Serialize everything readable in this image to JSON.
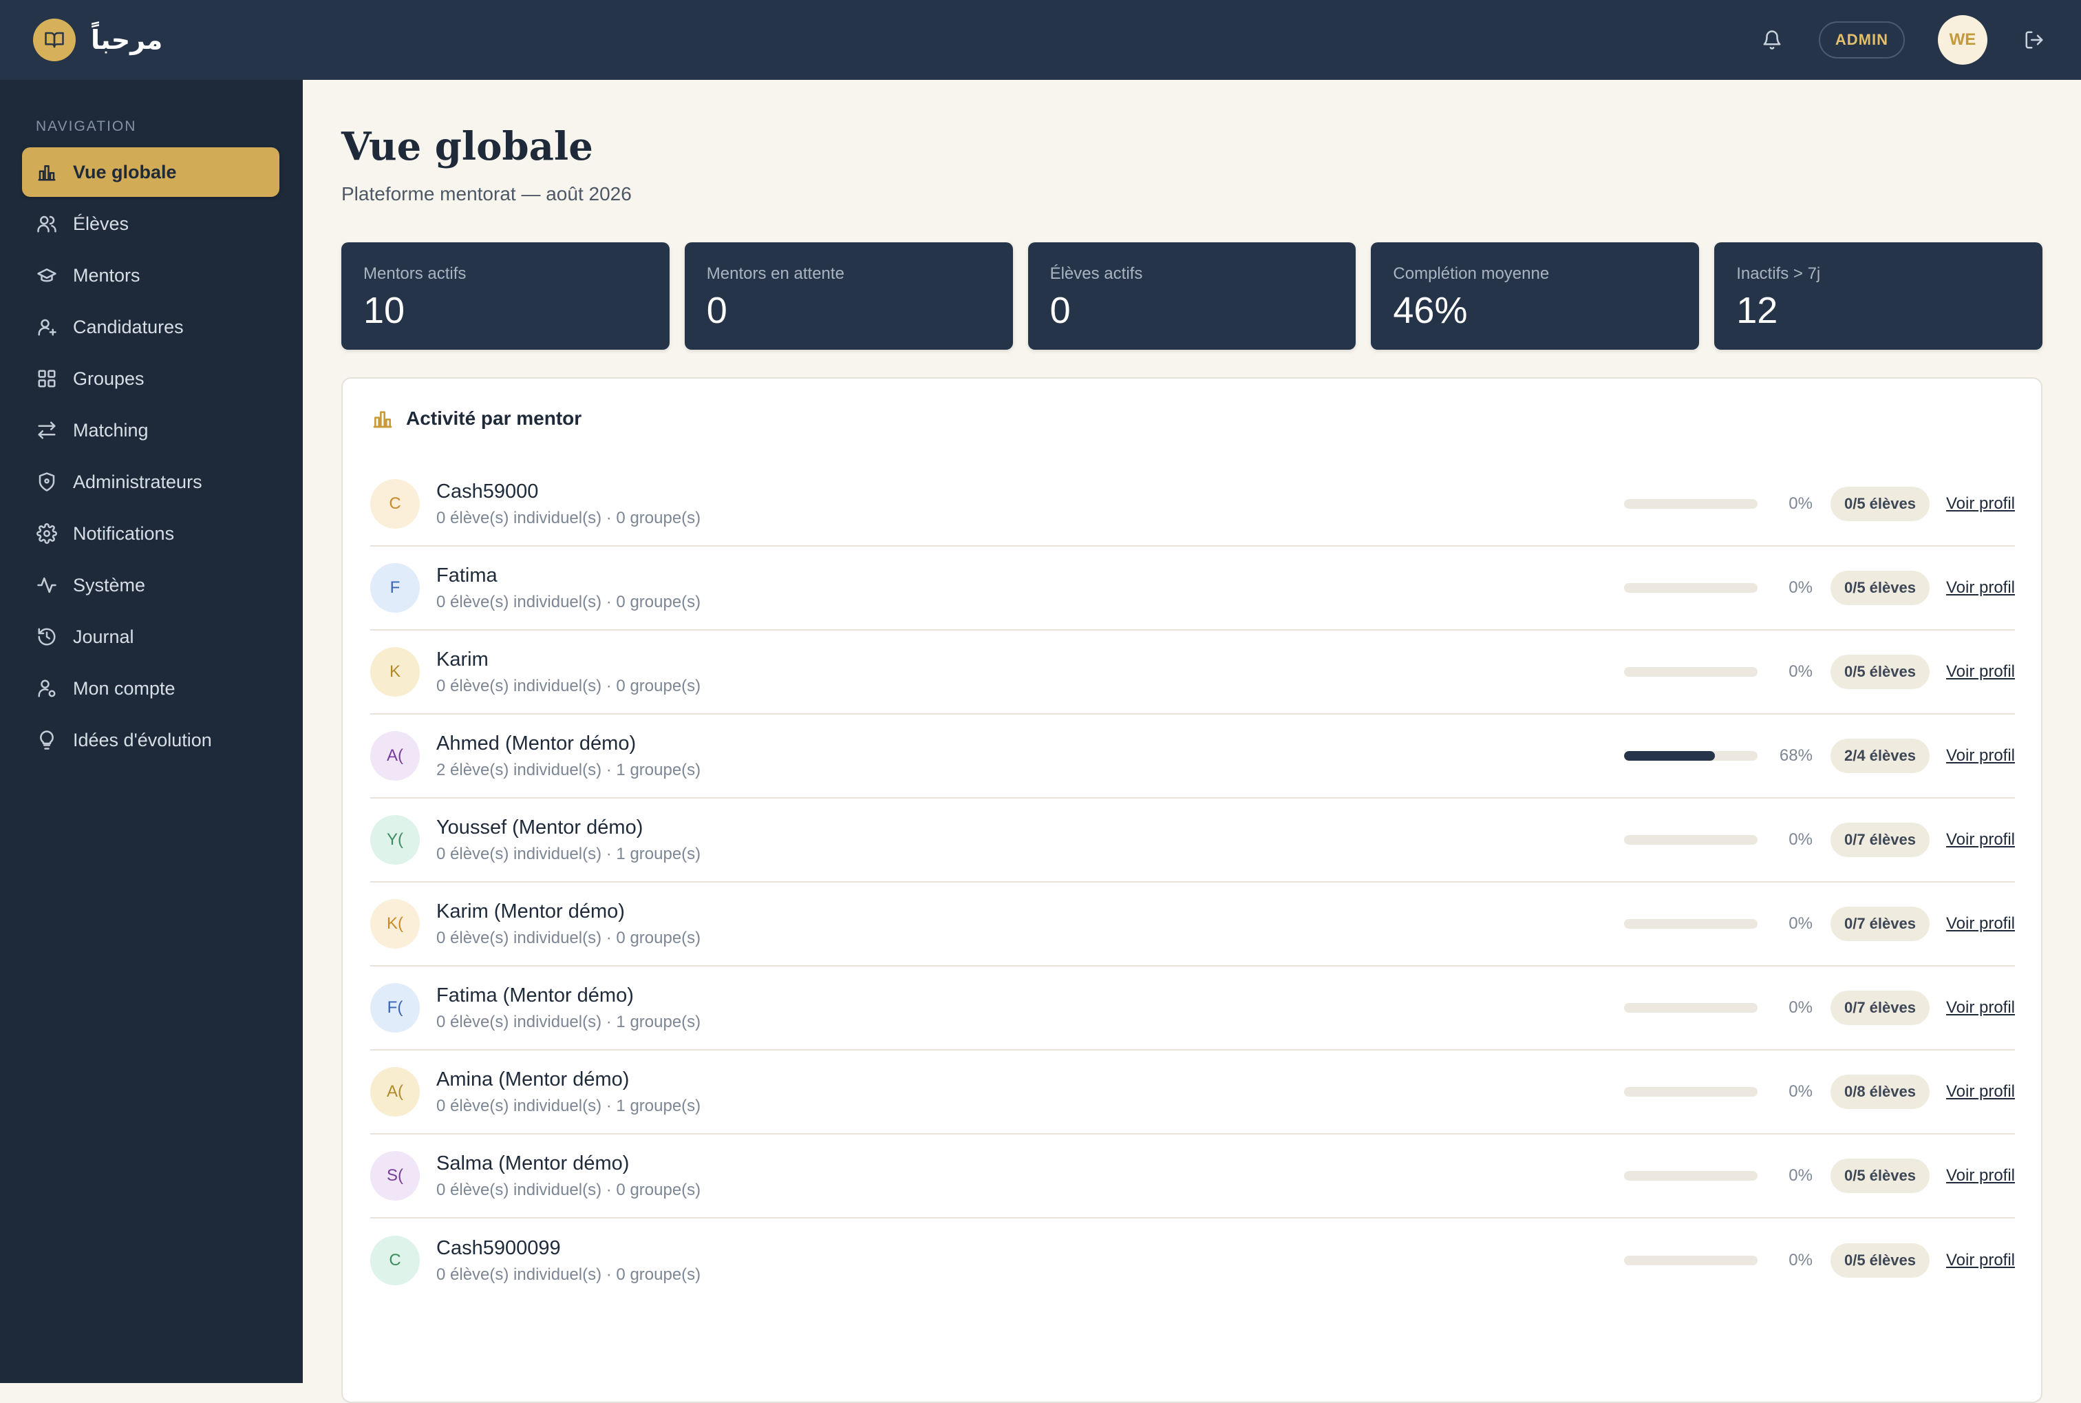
{
  "app": {
    "brand_name": "مرحباً",
    "admin_badge": "ADMIN",
    "user_initials": "WE"
  },
  "colors": {
    "accent": "#d1ab55",
    "dark_navy": "#1e2a3a",
    "panel_navy": "#253448",
    "background": "#f8f5ee"
  },
  "sidebar": {
    "heading": "NAVIGATION",
    "items": [
      {
        "label": "Vue globale",
        "icon": "bar-chart-icon",
        "active": true
      },
      {
        "label": "Élèves",
        "icon": "users-icon"
      },
      {
        "label": "Mentors",
        "icon": "graduation-cap-icon"
      },
      {
        "label": "Candidatures",
        "icon": "user-plus-icon"
      },
      {
        "label": "Groupes",
        "icon": "grid-icon"
      },
      {
        "label": "Matching",
        "icon": "arrows-swap-icon"
      },
      {
        "label": "Administrateurs",
        "icon": "shield-icon"
      },
      {
        "label": "Notifications",
        "icon": "gear-icon"
      },
      {
        "label": "Système",
        "icon": "activity-icon"
      },
      {
        "label": "Journal",
        "icon": "history-icon"
      },
      {
        "label": "Mon compte",
        "icon": "user-settings-icon"
      },
      {
        "label": "Idées d'évolution",
        "icon": "lightbulb-icon"
      }
    ]
  },
  "main": {
    "title": "Vue globale",
    "subtitle": "Plateforme mentorat — août 2026",
    "stats": [
      {
        "label": "Mentors actifs",
        "value": "10"
      },
      {
        "label": "Mentors en attente",
        "value": "0"
      },
      {
        "label": "Élèves actifs",
        "value": "0"
      },
      {
        "label": "Complétion moyenne",
        "value": "46%"
      },
      {
        "label": "Inactifs > 7j",
        "value": "12"
      }
    ],
    "activity": {
      "title": "Activité par mentor",
      "link_label": "Voir profil",
      "rows": [
        {
          "initials": "C",
          "name": "Cash59000",
          "sub": "0 élève(s) individuel(s) · 0 groupe(s)",
          "progress": 0,
          "pct": "0%",
          "capacity": "0/5 élèves",
          "avatar_bg": "#fbefd9",
          "avatar_fg": "#c98a2a"
        },
        {
          "initials": "F",
          "name": "Fatima",
          "sub": "0 élève(s) individuel(s) · 0 groupe(s)",
          "progress": 0,
          "pct": "0%",
          "capacity": "0/5 élèves",
          "avatar_bg": "#e1ecfb",
          "avatar_fg": "#3a64b8"
        },
        {
          "initials": "K",
          "name": "Karim",
          "sub": "0 élève(s) individuel(s) · 0 groupe(s)",
          "progress": 0,
          "pct": "0%",
          "capacity": "0/5 élèves",
          "avatar_bg": "#f8edcf",
          "avatar_fg": "#b08a2c"
        },
        {
          "initials": "A(",
          "name": "Ahmed (Mentor démo)",
          "sub": "2 élève(s) individuel(s) · 1 groupe(s)",
          "progress": 68,
          "pct": "68%",
          "capacity": "2/4 élèves",
          "avatar_bg": "#f1e6f8",
          "avatar_fg": "#7a3c9c"
        },
        {
          "initials": "Y(",
          "name": "Youssef (Mentor démo)",
          "sub": "0 élève(s) individuel(s) · 1 groupe(s)",
          "progress": 0,
          "pct": "0%",
          "capacity": "0/7 élèves",
          "avatar_bg": "#def3e9",
          "avatar_fg": "#3d8c63"
        },
        {
          "initials": "K(",
          "name": "Karim (Mentor démo)",
          "sub": "0 élève(s) individuel(s) · 0 groupe(s)",
          "progress": 0,
          "pct": "0%",
          "capacity": "0/7 élèves",
          "avatar_bg": "#fbefd9",
          "avatar_fg": "#c98a2a"
        },
        {
          "initials": "F(",
          "name": "Fatima (Mentor démo)",
          "sub": "0 élève(s) individuel(s) · 1 groupe(s)",
          "progress": 0,
          "pct": "0%",
          "capacity": "0/7 élèves",
          "avatar_bg": "#e1ecfb",
          "avatar_fg": "#3a64b8"
        },
        {
          "initials": "A(",
          "name": "Amina (Mentor démo)",
          "sub": "0 élève(s) individuel(s) · 1 groupe(s)",
          "progress": 0,
          "pct": "0%",
          "capacity": "0/8 élèves",
          "avatar_bg": "#f8edcf",
          "avatar_fg": "#b08a2c"
        },
        {
          "initials": "S(",
          "name": "Salma (Mentor démo)",
          "sub": "0 élève(s) individuel(s) · 0 groupe(s)",
          "progress": 0,
          "pct": "0%",
          "capacity": "0/5 élèves",
          "avatar_bg": "#f1e6f8",
          "avatar_fg": "#7a3c9c"
        },
        {
          "initials": "C",
          "name": "Cash5900099",
          "sub": "0 élève(s) individuel(s) · 0 groupe(s)",
          "progress": 0,
          "pct": "0%",
          "capacity": "0/5 élèves",
          "avatar_bg": "#def3e9",
          "avatar_fg": "#3d8c63"
        }
      ]
    }
  }
}
